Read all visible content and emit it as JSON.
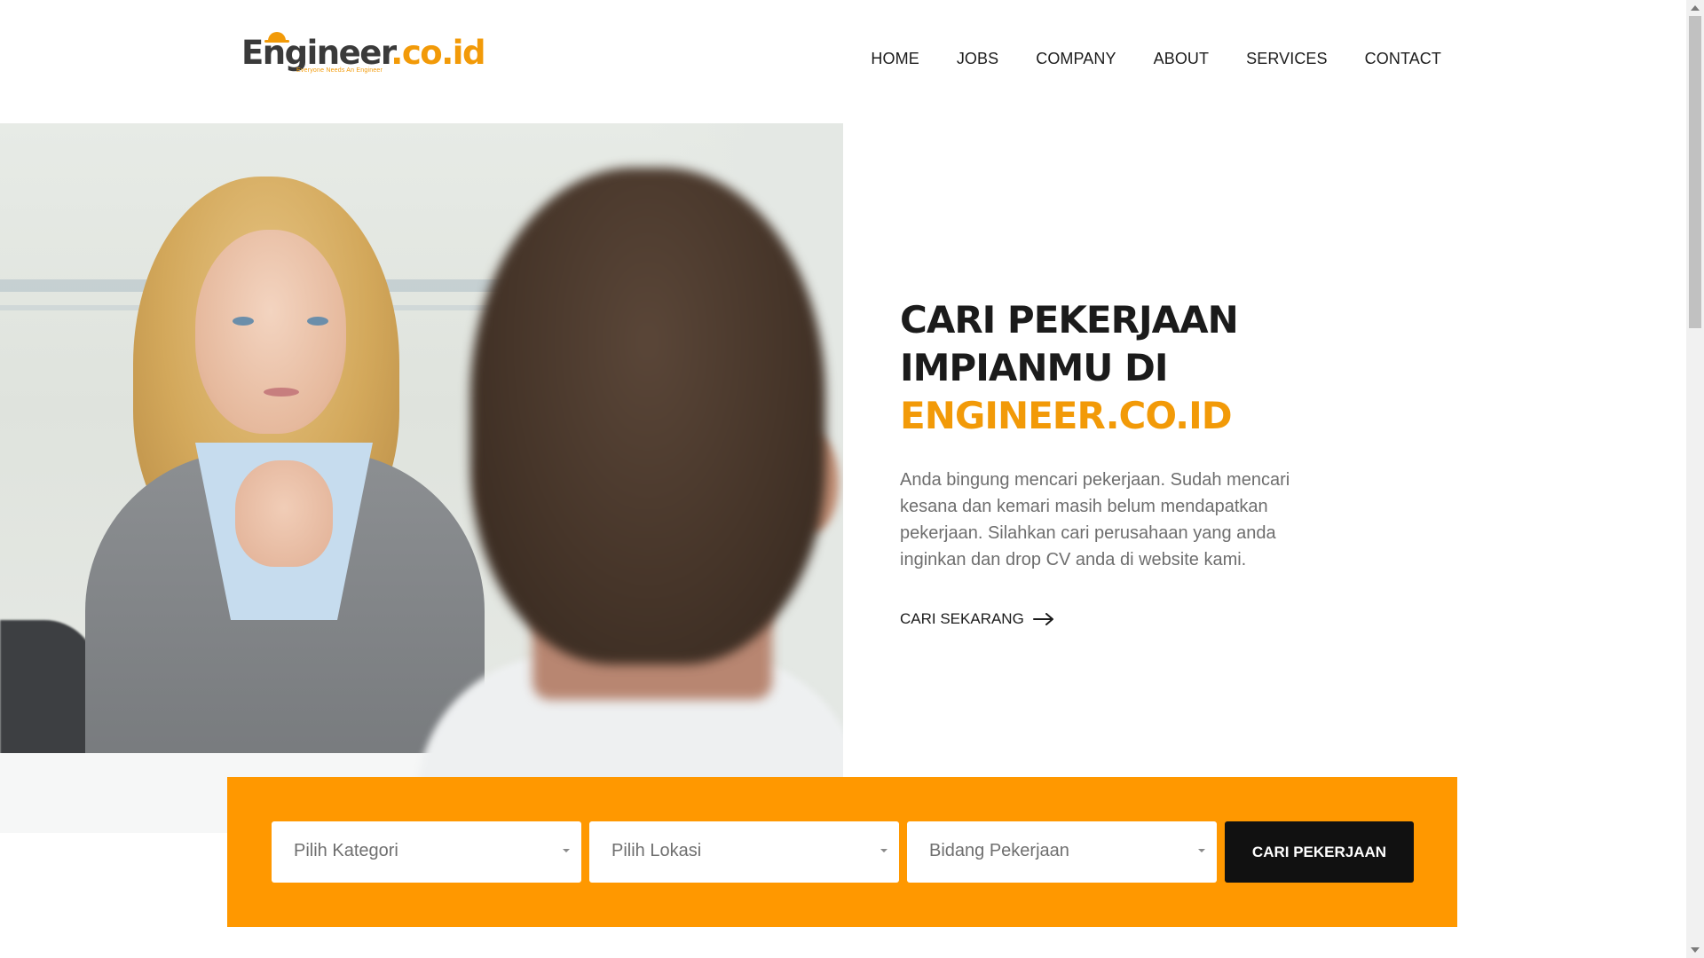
{
  "header": {
    "logo": {
      "main_dark": "Engineer",
      "main_accent": ".co.id",
      "tagline": "Everyone Needs An Engineer"
    },
    "nav": [
      {
        "label": "HOME"
      },
      {
        "label": "JOBS"
      },
      {
        "label": "COMPANY"
      },
      {
        "label": "ABOUT"
      },
      {
        "label": "SERVICES"
      },
      {
        "label": "CONTACT"
      }
    ]
  },
  "hero": {
    "title_line1": "CARI PEKERJAAN",
    "title_line2": "IMPIANMU DI",
    "title_accent": "ENGINEER.CO.ID",
    "description": "Anda bingung mencari pekerjaan. Sudah mencari kesana dan kemari masih belum mendapatkan pekerjaan. Silahkan cari perusahaan yang anda inginkan dan drop CV anda di website kami.",
    "cta_label": "CARI SEKARANG",
    "cta_icon": "arrow-right-icon"
  },
  "search": {
    "category_placeholder": "Pilih Kategori",
    "location_placeholder": "Pilih Lokasi",
    "field_placeholder": "Bidang Pekerjaan",
    "button_label": "CARI PEKERJAAN"
  },
  "colors": {
    "accent": "#f29a08",
    "search_panel": "#ff9800",
    "button_bg": "#111111",
    "text_dark": "#1b1b1b",
    "text_muted": "#6e6e6e"
  }
}
